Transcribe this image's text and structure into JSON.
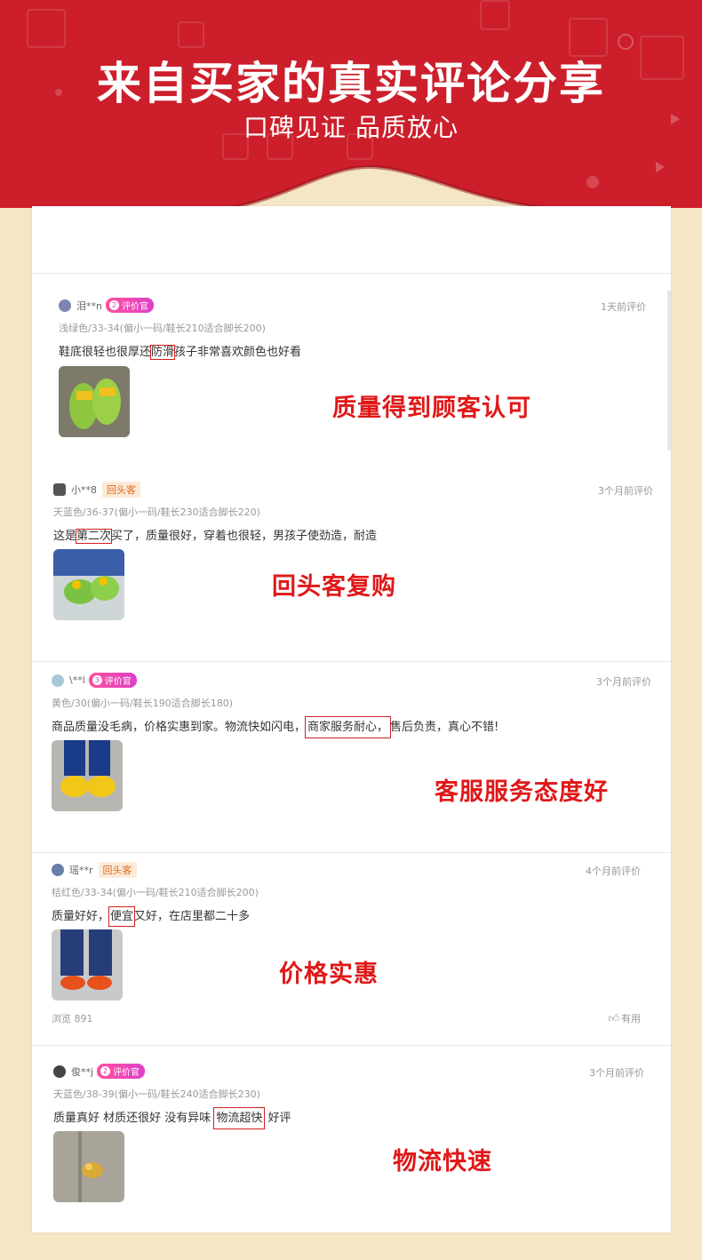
{
  "banner": {
    "title": "来自买家的真实评论分享",
    "subtitle": "口碑见证 品质放心"
  },
  "reviews": [
    {
      "user": "泪**n",
      "badge": "评价官",
      "badge_level": "2",
      "time": "1天前评价",
      "spec": "浅绿色/33-34(偏小一码/鞋长210适合脚长200)",
      "text_before": "鞋底很轻也很厚还",
      "text_highlight": "防滑",
      "text_after": "孩子非常喜欢颜色也好看",
      "callout": "质量得到顾客认可"
    },
    {
      "user": "小**8",
      "badge": "回头客",
      "time": "3个月前评价",
      "spec": "天蓝色/36-37(偏小一码/鞋长230适合脚长220)",
      "text_before": "这是",
      "text_highlight": "第二次",
      "text_after": "买了，质量很好，穿着也很轻，男孩子使劲造，耐造",
      "callout": "回头客复购"
    },
    {
      "user": "\\**l",
      "badge": "评价官",
      "badge_level": "3",
      "time": "3个月前评价",
      "spec": "黄色/30(偏小一码/鞋长190适合脚长180)",
      "text_before": "商品质量没毛病，价格实惠到家。物流快如闪电，",
      "text_highlight": "商家服务耐心，",
      "text_after": "售后负责，真心不错!",
      "callout": "客服服务态度好"
    },
    {
      "user": "瑶**r",
      "badge": "回头客",
      "time": "4个月前评价",
      "spec": "桔红色/33-34(偏小一码/鞋长210适合脚长200)",
      "text_before": "质量好好，",
      "text_highlight": "便宜",
      "text_after": "又好，在店里都二十多",
      "views": "浏览 891",
      "useful": "有用",
      "callout": "价格实惠"
    },
    {
      "user": "俊**j",
      "badge": "评价官",
      "badge_level": "2",
      "time": "3个月前评价",
      "spec": "天蓝色/38-39(偏小一码/鞋长240适合脚长230)",
      "text_before": "质量真好 材质还很好 没有异味 ",
      "text_highlight": "物流超快",
      "text_after": " 好评",
      "callout": "物流快速"
    }
  ],
  "colors": {
    "banner_red": "#cc1f2b",
    "callout_red": "#e01818",
    "page_bg": "#f5e6c4"
  }
}
